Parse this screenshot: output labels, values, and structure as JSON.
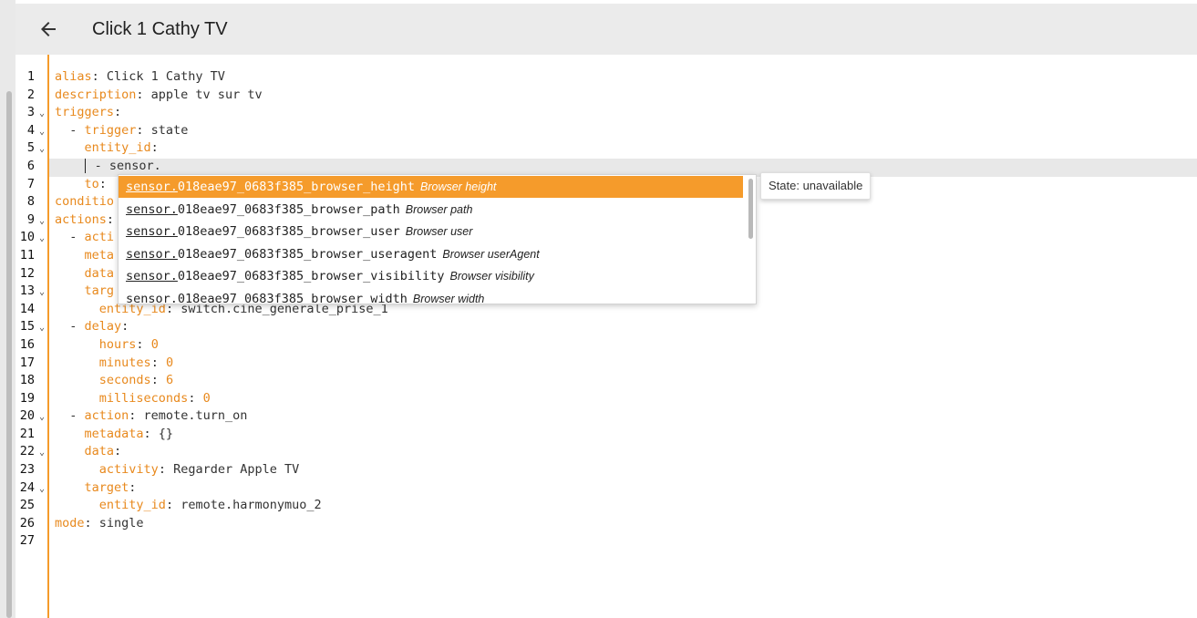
{
  "header": {
    "title": "Click 1 Cathy TV",
    "back_icon": "arrow-left-icon"
  },
  "editor": {
    "line_numbers": [
      "1",
      "2",
      "3",
      "4",
      "5",
      "6",
      "7",
      "8",
      "9",
      "10",
      "11",
      "12",
      "13",
      "14",
      "15",
      "16",
      "17",
      "18",
      "19",
      "20",
      "21",
      "22",
      "23",
      "24",
      "25",
      "26",
      "27"
    ],
    "fold_lines": [
      3,
      4,
      5,
      9,
      10,
      13,
      15,
      20,
      22,
      24
    ],
    "lines": [
      [
        {
          "t": "alias",
          "k": 1
        },
        {
          "t": ": Click 1 Cathy TV"
        }
      ],
      [
        {
          "t": "description",
          "k": 1
        },
        {
          "t": ": apple tv sur tv"
        }
      ],
      [
        {
          "t": "triggers",
          "k": 1
        },
        {
          "t": ":"
        }
      ],
      [
        {
          "t": "  - "
        },
        {
          "t": "trigger",
          "k": 1
        },
        {
          "t": ": state"
        }
      ],
      [
        {
          "t": "    "
        },
        {
          "t": "entity_id",
          "k": 1
        },
        {
          "t": ":"
        }
      ],
      [
        {
          "t": "    "
        },
        {
          "cursor": 1
        },
        {
          "t": " - sensor."
        }
      ],
      [
        {
          "t": "    "
        },
        {
          "t": "to",
          "k": 1
        },
        {
          "t": ":"
        }
      ],
      [
        {
          "t": "conditio",
          "k": 1
        }
      ],
      [
        {
          "t": "actions",
          "k": 1
        },
        {
          "t": ":"
        }
      ],
      [
        {
          "t": "  - "
        },
        {
          "t": "acti",
          "k": 1
        }
      ],
      [
        {
          "t": "    "
        },
        {
          "t": "meta",
          "k": 1
        }
      ],
      [
        {
          "t": "    "
        },
        {
          "t": "data",
          "k": 1
        }
      ],
      [
        {
          "t": "    "
        },
        {
          "t": "targ",
          "k": 1
        }
      ],
      [
        {
          "t": "      "
        },
        {
          "t": "entity_id",
          "k": 1
        },
        {
          "t": ": switch.cine_generale_prise_1"
        }
      ],
      [
        {
          "t": "  - "
        },
        {
          "t": "delay",
          "k": 1
        },
        {
          "t": ":"
        }
      ],
      [
        {
          "t": "      "
        },
        {
          "t": "hours",
          "k": 1
        },
        {
          "t": ": "
        },
        {
          "t": "0",
          "k": 1
        }
      ],
      [
        {
          "t": "      "
        },
        {
          "t": "minutes",
          "k": 1
        },
        {
          "t": ": "
        },
        {
          "t": "0",
          "k": 1
        }
      ],
      [
        {
          "t": "      "
        },
        {
          "t": "seconds",
          "k": 1
        },
        {
          "t": ": "
        },
        {
          "t": "6",
          "k": 1
        }
      ],
      [
        {
          "t": "      "
        },
        {
          "t": "milliseconds",
          "k": 1
        },
        {
          "t": ": "
        },
        {
          "t": "0",
          "k": 1
        }
      ],
      [
        {
          "t": "  - "
        },
        {
          "t": "action",
          "k": 1
        },
        {
          "t": ": remote.turn_on"
        }
      ],
      [
        {
          "t": "    "
        },
        {
          "t": "metadata",
          "k": 1
        },
        {
          "t": ": {}"
        }
      ],
      [
        {
          "t": "    "
        },
        {
          "t": "data",
          "k": 1
        },
        {
          "t": ":"
        }
      ],
      [
        {
          "t": "      "
        },
        {
          "t": "activity",
          "k": 1
        },
        {
          "t": ": Regarder Apple TV"
        }
      ],
      [
        {
          "t": "    "
        },
        {
          "t": "target",
          "k": 1
        },
        {
          "t": ":"
        }
      ],
      [
        {
          "t": "      "
        },
        {
          "t": "entity_id",
          "k": 1
        },
        {
          "t": ": remote.harmonymuo_2"
        }
      ],
      [
        {
          "t": "mode",
          "k": 1
        },
        {
          "t": ": single"
        }
      ],
      []
    ]
  },
  "autocomplete": {
    "match": "sensor.",
    "items": [
      {
        "id_rest": "018eae97_0683f385_browser_height",
        "name": "Browser height",
        "selected": true
      },
      {
        "id_rest": "018eae97_0683f385_browser_path",
        "name": "Browser path"
      },
      {
        "id_rest": "018eae97_0683f385_browser_user",
        "name": "Browser user"
      },
      {
        "id_rest": "018eae97_0683f385_browser_useragent",
        "name": "Browser userAgent"
      },
      {
        "id_rest": "018eae97_0683f385_browser_visibility",
        "name": "Browser visibility"
      },
      {
        "id_rest": "018eae97_0683f385_browser_width",
        "name": "Browser width"
      }
    ]
  },
  "tooltip": {
    "text": "State: unavailable"
  },
  "colors": {
    "accent": "#f59b2b",
    "key": "#e8891d",
    "header_bg": "#ebebeb"
  }
}
